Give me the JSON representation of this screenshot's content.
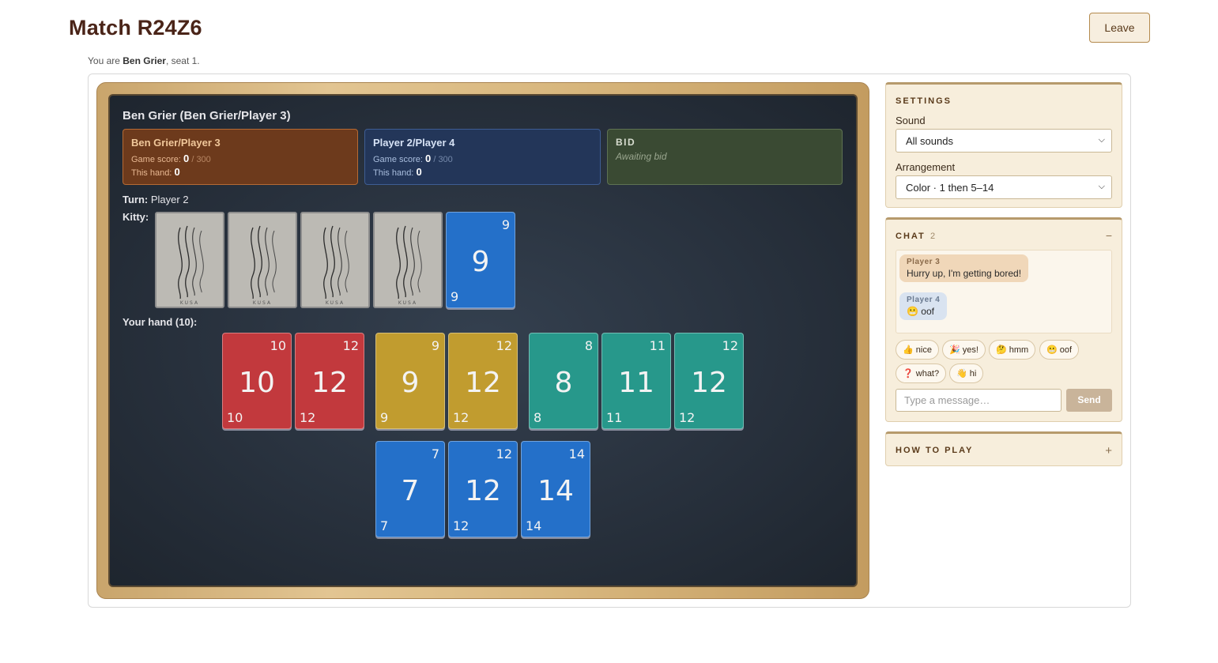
{
  "header": {
    "title": "Match R24Z6",
    "leave_label": "Leave"
  },
  "seat": {
    "prefix": "You are ",
    "player": "Ben Grier",
    "suffix": ", seat 1."
  },
  "table": {
    "player_heading": "Ben Grier (Ben Grier/Player 3)",
    "teams": [
      {
        "name": "Ben Grier/Player 3",
        "game_score_label": "Game score:",
        "game_score": "0",
        "target": "/ 300",
        "hand_label": "This hand:",
        "hand_score": "0"
      },
      {
        "name": "Player 2/Player 4",
        "game_score_label": "Game score:",
        "game_score": "0",
        "target": "/ 300",
        "hand_label": "This hand:",
        "hand_score": "0"
      }
    ],
    "bid": {
      "title": "BID",
      "status": "Awaiting bid"
    },
    "turn": {
      "label": "Turn:",
      "player": "Player 2"
    },
    "kitty": {
      "label": "Kitty:",
      "face_down_count": 4,
      "back_brand": "KUSA",
      "face_up": {
        "color": "blue",
        "value": "9"
      }
    },
    "hand": {
      "label": "Your hand (10):",
      "cards": [
        {
          "color": "red",
          "value": "10"
        },
        {
          "color": "red",
          "value": "12"
        },
        {
          "color": "yellow",
          "value": "9"
        },
        {
          "color": "yellow",
          "value": "12"
        },
        {
          "color": "teal",
          "value": "8"
        },
        {
          "color": "teal",
          "value": "11"
        },
        {
          "color": "teal",
          "value": "12"
        },
        {
          "color": "blue",
          "value": "7"
        },
        {
          "color": "blue",
          "value": "12"
        },
        {
          "color": "blue",
          "value": "14"
        }
      ]
    },
    "colors": {
      "red": "#c2393d",
      "yellow": "#c19c2f",
      "teal": "#27988b",
      "blue": "#2470c9"
    }
  },
  "settings": {
    "title": "SETTINGS",
    "sound_label": "Sound",
    "sound_value": "All sounds",
    "arrangement_label": "Arrangement",
    "arrangement_value": "Color · 1 then 5–14"
  },
  "chat": {
    "title": "CHAT",
    "count": "2",
    "collapse_icon": "−",
    "messages": [
      {
        "author": "Player 3",
        "text": "Hurry up, I'm getting bored!"
      },
      {
        "author": "Player 4",
        "text": "😬 oof"
      }
    ],
    "quick_replies": [
      "👍 nice",
      "🎉 yes!",
      "🤔 hmm",
      "😬 oof",
      "❓ what?",
      "👋 hi"
    ],
    "input_placeholder": "Type a message…",
    "send_label": "Send"
  },
  "how_to_play": {
    "title": "HOW TO PLAY",
    "expand_icon": "+"
  }
}
